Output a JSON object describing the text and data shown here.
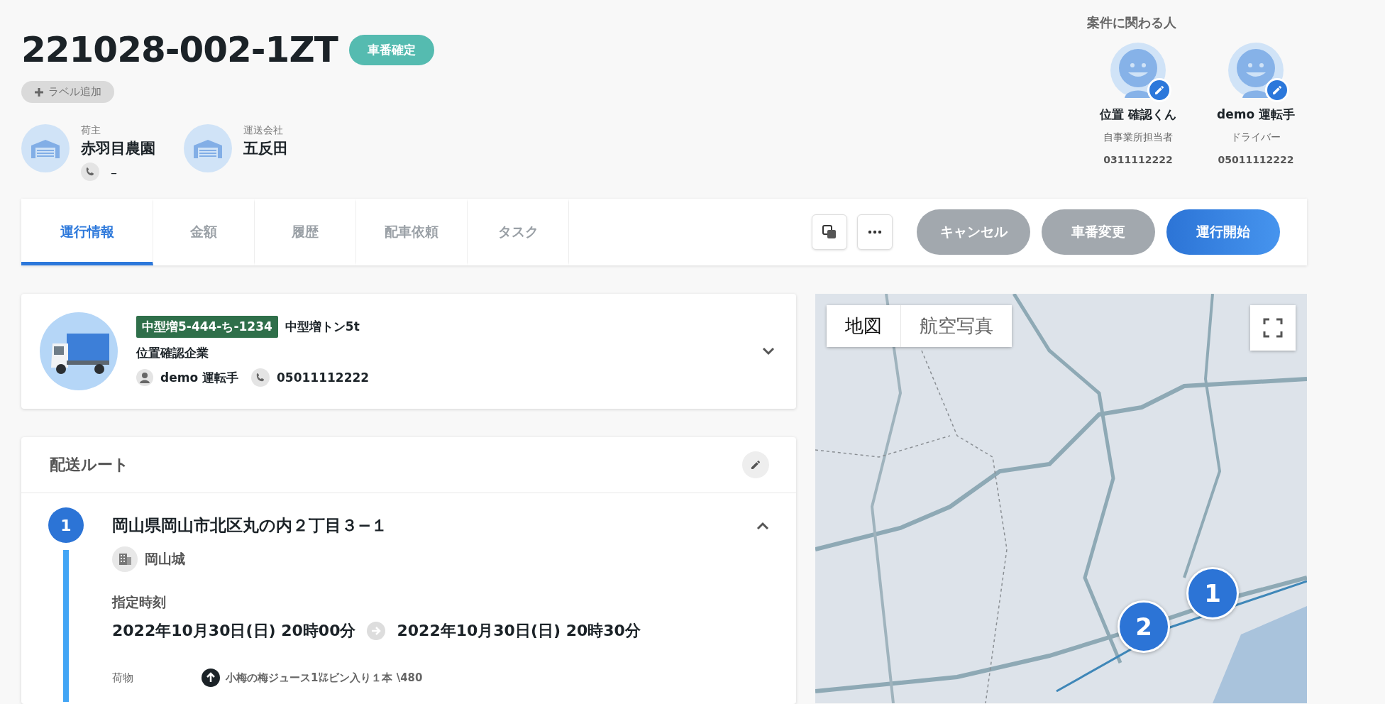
{
  "order": {
    "number": "221028-002-1ZT",
    "status": "車番確定",
    "add_label_button": "ラベル追加"
  },
  "parties": [
    {
      "role": "荷主",
      "name": "赤羽目農園",
      "phone": "–"
    },
    {
      "role": "運送会社",
      "name": "五反田"
    }
  ],
  "people": {
    "title": "案件に関わる人",
    "members": [
      {
        "name": "位置 確認くん",
        "role": "自事業所担当者",
        "phone": "0311112222"
      },
      {
        "name": "demo 運転手",
        "role": "ドライバー",
        "phone": "05011112222"
      }
    ]
  },
  "tabs": [
    {
      "label": "運行情報",
      "selected": true
    },
    {
      "label": "金額",
      "selected": false
    },
    {
      "label": "履歴",
      "selected": false
    },
    {
      "label": "配車依頼",
      "selected": false
    },
    {
      "label": "タスク",
      "selected": false
    }
  ],
  "actions": [
    {
      "label": "キャンセル",
      "kind": "secondary"
    },
    {
      "label": "車番変更",
      "kind": "secondary"
    },
    {
      "label": "運行開始",
      "kind": "primary"
    }
  ],
  "vehicle": {
    "plate": "中型増5-444-ち-1234",
    "type": "中型増トン5t",
    "company": "位置確認企業",
    "driver": "demo 運転手",
    "phone": "05011112222",
    "expanded": false
  },
  "route": {
    "title": "配送ルート",
    "stops": [
      {
        "number": "1",
        "address": "岡山県岡山市北区丸の内２丁目３−１",
        "place": "岡山城",
        "expanded": true,
        "time_label": "指定時刻",
        "time_from": "2022年10月30日(日) 20時00分",
        "time_to": "2022年10月30日(日) 20時30分",
        "cargo_label": "荷物",
        "cargo": "小梅の梅ジュース1㍑ビン入り１本 \\480"
      }
    ]
  },
  "map": {
    "view_tabs": [
      {
        "label": "地図",
        "selected": true
      },
      {
        "label": "航空写真",
        "selected": false
      }
    ],
    "markers": [
      {
        "label": "1"
      },
      {
        "label": "2"
      }
    ]
  }
}
